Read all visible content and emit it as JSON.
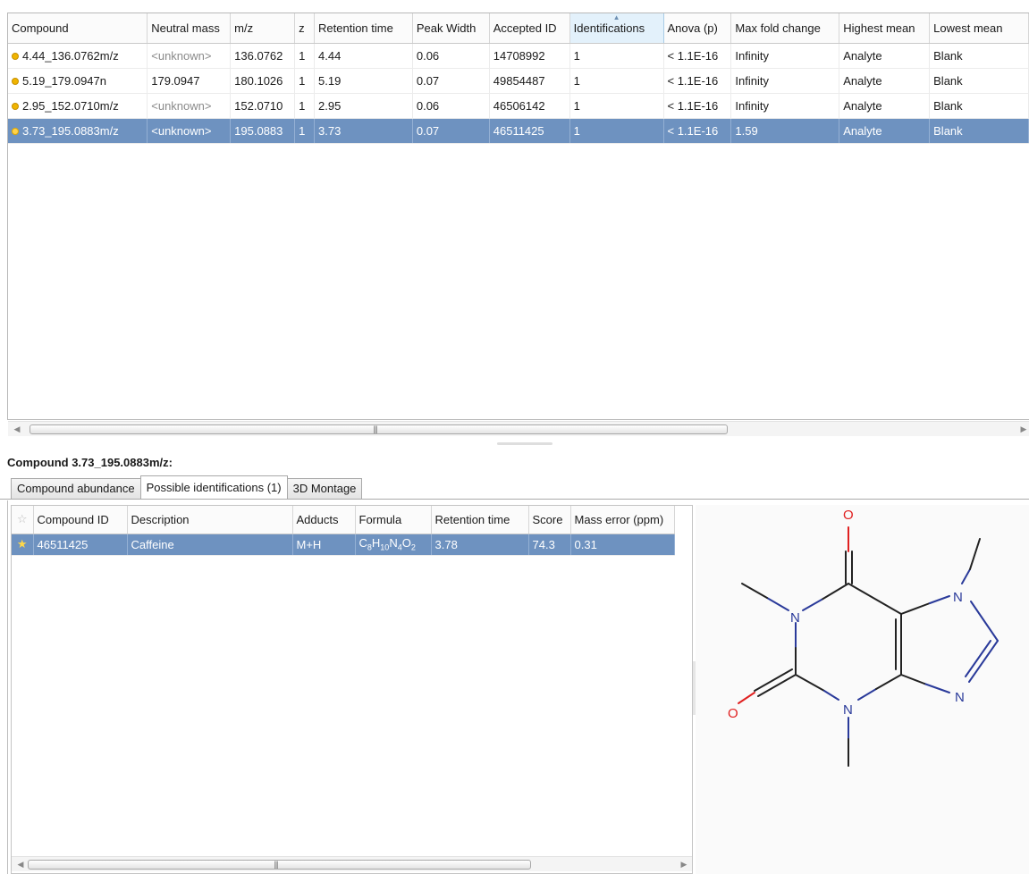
{
  "compounds_table": {
    "columns": [
      "Compound",
      "Neutral mass",
      "m/z",
      "z",
      "Retention time",
      "Peak Width",
      "Accepted ID",
      "Identifications",
      "Anova (p)",
      "Max fold change",
      "Highest mean",
      "Lowest mean"
    ],
    "sorted_column": "Identifications",
    "rows": [
      {
        "compound": "4.44_136.0762m/z",
        "neutral_mass": "<unknown>",
        "mz": "136.0762",
        "z": "1",
        "retention_time": "4.44",
        "peak_width": "0.06",
        "accepted_id": "14708992",
        "identifications": "1",
        "anova": "< 1.1E-16",
        "max_fold": "Infinity",
        "highest_mean": "Analyte",
        "lowest_mean": "Blank",
        "selected": false
      },
      {
        "compound": "5.19_179.0947n",
        "neutral_mass": "179.0947",
        "mz": "180.1026",
        "z": "1",
        "retention_time": "5.19",
        "peak_width": "0.07",
        "accepted_id": "49854487",
        "identifications": "1",
        "anova": "< 1.1E-16",
        "max_fold": "Infinity",
        "highest_mean": "Analyte",
        "lowest_mean": "Blank",
        "selected": false
      },
      {
        "compound": "2.95_152.0710m/z",
        "neutral_mass": "<unknown>",
        "mz": "152.0710",
        "z": "1",
        "retention_time": "2.95",
        "peak_width": "0.06",
        "accepted_id": "46506142",
        "identifications": "1",
        "anova": "< 1.1E-16",
        "max_fold": "Infinity",
        "highest_mean": "Analyte",
        "lowest_mean": "Blank",
        "selected": false
      },
      {
        "compound": "3.73_195.0883m/z",
        "neutral_mass": "<unknown>",
        "mz": "195.0883",
        "z": "1",
        "retention_time": "3.73",
        "peak_width": "0.07",
        "accepted_id": "46511425",
        "identifications": "1",
        "anova": "< 1.1E-16",
        "max_fold": "1.59",
        "highest_mean": "Analyte",
        "lowest_mean": "Blank",
        "selected": true
      }
    ]
  },
  "detail": {
    "title": "Compound 3.73_195.0883m/z:",
    "tabs": [
      "Compound abundance",
      "Possible identifications (1)",
      "3D Montage"
    ],
    "active_tab": "Possible identifications (1)"
  },
  "identifications_table": {
    "columns": [
      "Compound ID",
      "Description",
      "Adducts",
      "Formula",
      "Retention time",
      "Score",
      "Mass error (ppm)"
    ],
    "rows": [
      {
        "compound_id": "46511425",
        "description": "Caffeine",
        "adducts": "M+H",
        "formula": "C8H10N4O2",
        "retention_time": "3.78",
        "score": "74.3",
        "mass_error": "0.31",
        "starred": true,
        "selected": true
      }
    ]
  },
  "structure": {
    "atom_O": "O",
    "atom_N": "N",
    "colors": {
      "oxygen": "#e02020",
      "nitrogen": "#2a3a9a",
      "carbon": "#222222"
    }
  },
  "colors": {
    "selection": "#6e92c0",
    "sorted_header": "#e3f1fb",
    "marker": "#f0b400"
  }
}
